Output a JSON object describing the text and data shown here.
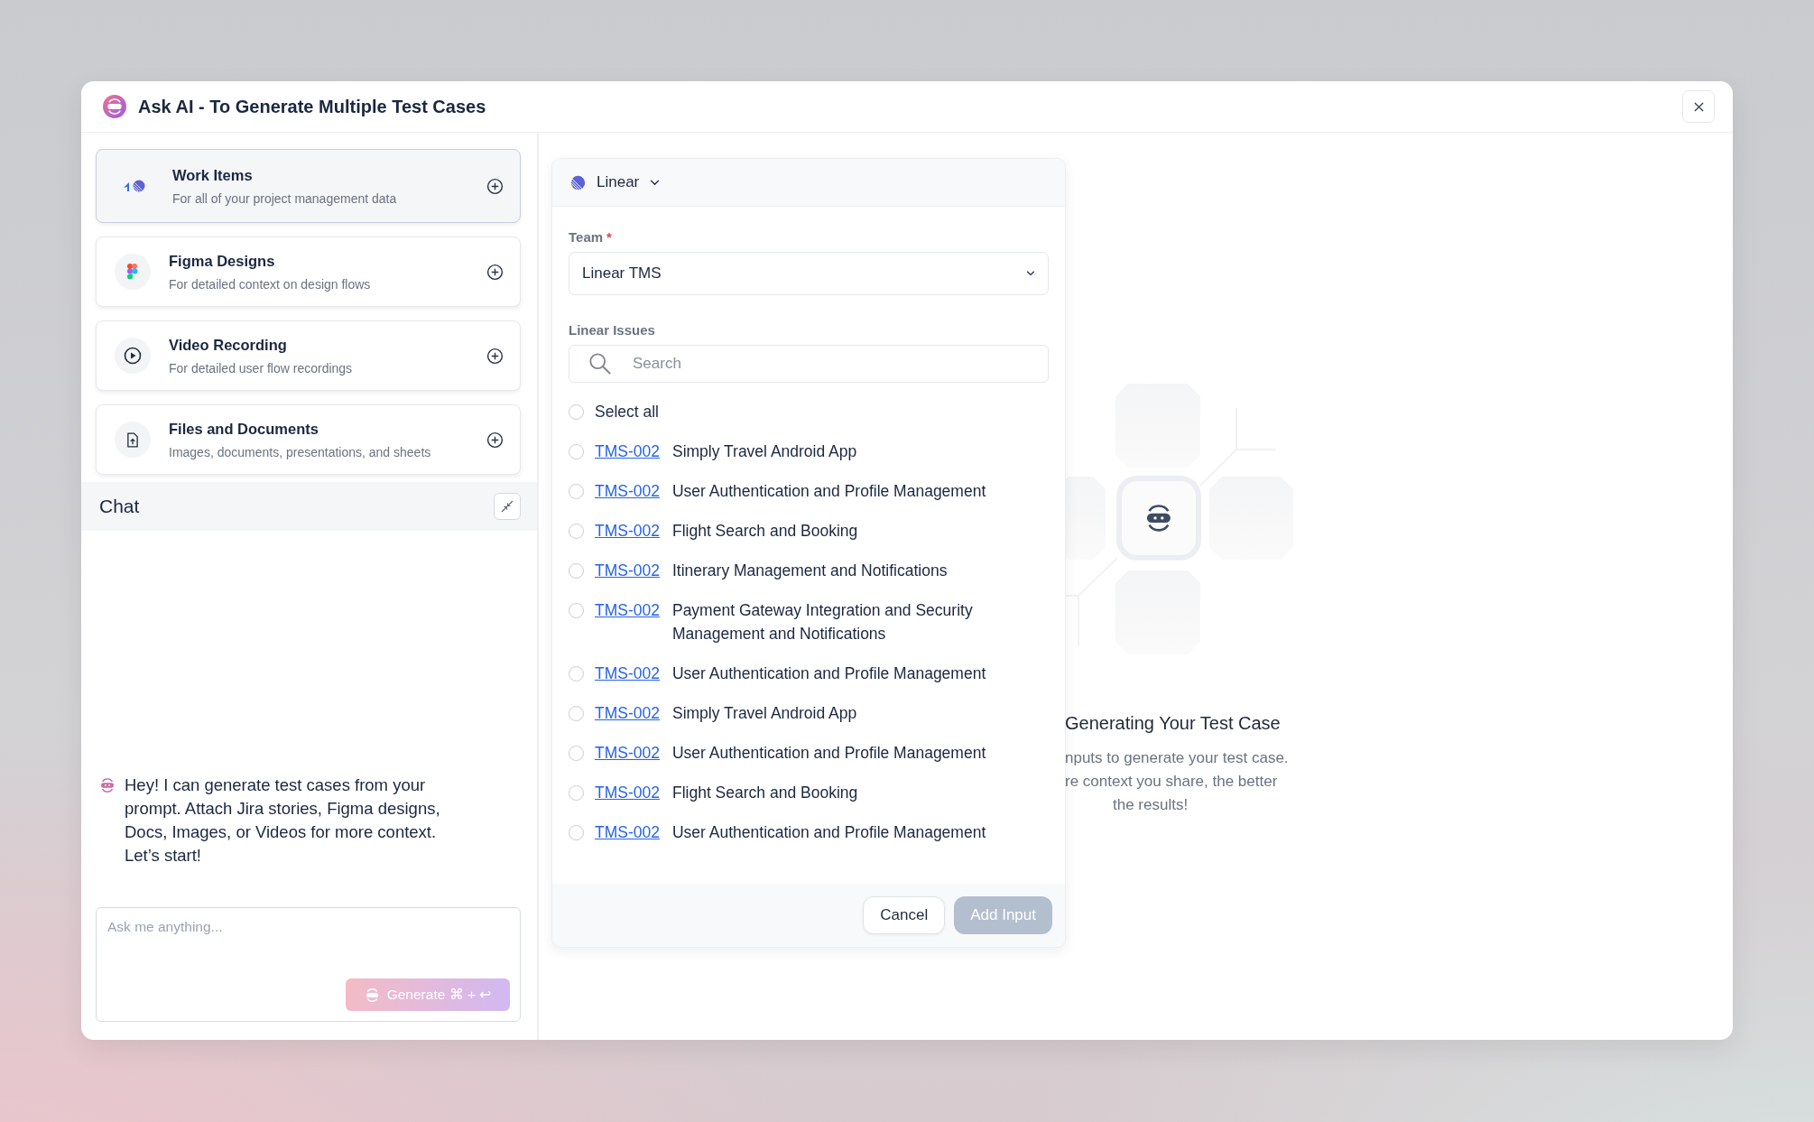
{
  "dialog": {
    "title": "Ask AI - To Generate Multiple Test Cases"
  },
  "sources": [
    {
      "kind": "work-items",
      "title": "Work Items",
      "subtitle": "For all of your project management data",
      "selected": true
    },
    {
      "kind": "design",
      "title": "Figma Designs",
      "subtitle": "For detailed context on design flows",
      "selected": false
    },
    {
      "kind": "video",
      "title": "Video Recording",
      "subtitle": "For detailed user flow recordings",
      "selected": false
    },
    {
      "kind": "files",
      "title": "Files and Documents",
      "subtitle": "Images, documents, presentations, and sheets",
      "selected": false
    }
  ],
  "chat": {
    "title": "Chat",
    "message": "Hey! I can generate test cases from your prompt. Attach Jira stories, Figma designs, Docs, Images, or Videos for more context. Let’s start!",
    "input": {
      "placeholder": "Ask me anything..."
    },
    "generate_button": {
      "label": "Generate ⌘ + ↩",
      "disabled": true
    }
  },
  "integration": {
    "provider": "Linear",
    "team_label": "Team",
    "required_mark": "*",
    "team_value": "Linear TMS",
    "issues_label": "Linear Issues",
    "search": {
      "placeholder": "Search"
    },
    "select_all": {
      "label": "Select all",
      "checked": false
    },
    "issues": [
      {
        "id": "TMS-002",
        "title": "Simply Travel Android App",
        "checked": false
      },
      {
        "id": "TMS-002",
        "title": "User Authentication and Profile Management",
        "checked": false
      },
      {
        "id": "TMS-002",
        "title": "Flight Search and Booking",
        "checked": false
      },
      {
        "id": "TMS-002",
        "title": "Itinerary Management and Notifications",
        "checked": false
      },
      {
        "id": "TMS-002",
        "title": "Payment Gateway Integration and Security Management and Notifications",
        "checked": false
      },
      {
        "id": "TMS-002",
        "title": "User Authentication and Profile Management",
        "checked": false
      },
      {
        "id": "TMS-002",
        "title": "Simply Travel Android App",
        "checked": false
      },
      {
        "id": "TMS-002",
        "title": "User Authentication and Profile Management",
        "checked": false
      },
      {
        "id": "TMS-002",
        "title": "Flight Search and Booking",
        "checked": false
      },
      {
        "id": "TMS-002",
        "title": "User Authentication and Profile Management",
        "checked": false
      }
    ],
    "buttons": [
      {
        "kind": "secondary",
        "label": "Cancel"
      },
      {
        "kind": "primary",
        "label": "Add Input",
        "disabled": true
      }
    ]
  },
  "status": {
    "title": "Generating Your Test Case",
    "lines": [
      "nputs to generate your test case.",
      "re context you share, the better",
      "the results!"
    ]
  }
}
